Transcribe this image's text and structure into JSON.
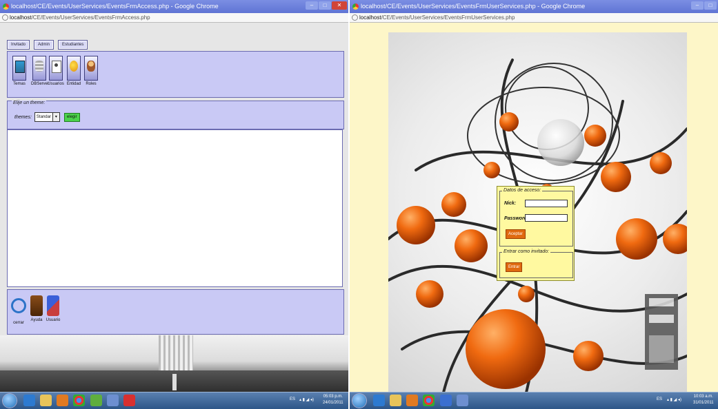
{
  "left": {
    "window_title": "localhost/CE/Events/UserServices/EventsFrmAccess.php - Google Chrome",
    "address": {
      "host": "localhost",
      "path": "/CE/Events/UserServices/EventsFrmAccess.php"
    },
    "tabs": [
      "Invitado",
      "Admin",
      "Estudiantes"
    ],
    "tools": [
      {
        "label": "Temas",
        "icon": "themes-icon"
      },
      {
        "label": "DBServer",
        "icon": "database-icon"
      },
      {
        "label": "Usuarios",
        "icon": "users-icon"
      },
      {
        "label": "Entidad",
        "icon": "entity-icon"
      },
      {
        "label": "Roles",
        "icon": "roles-icon"
      }
    ],
    "theme_panel": {
      "legend": "Elije un theme:",
      "label": "themes:",
      "selected": "Standar",
      "button": "elegir"
    },
    "bottom_tools": [
      {
        "label": "cerrar",
        "icon": "power-icon"
      },
      {
        "label": "Ayuda",
        "icon": "help-icon"
      },
      {
        "label": "Usuario",
        "icon": "user-icon"
      }
    ],
    "taskbar": {
      "tray": "ES",
      "time": "05:03 p.m.",
      "date": "24/01/2011"
    }
  },
  "right": {
    "window_title": "localhost/CE/Events/UserServices/EventsFrmUserServices.php - Google Chrome",
    "address": {
      "host": "localhost",
      "path": "/CE/Events/UserServices/EventsFrmUserServices.php"
    },
    "login": {
      "legend": "Datos de acceso:",
      "nick_label": "Nick:",
      "password_label": "Password:",
      "accept": "Aceptar",
      "guest_legend": "Entrar como invitado:",
      "enter": "Entrar"
    },
    "taskbar": {
      "tray": "ES",
      "time": "10:03 a.m.",
      "date": "31/01/2011"
    }
  },
  "colors": {
    "panel": "#c9c9f5",
    "panel_border": "#6a6ab0",
    "login_bg": "#fff9a0",
    "orange_button": "#e06a10",
    "green_button": "#4bd34b"
  }
}
